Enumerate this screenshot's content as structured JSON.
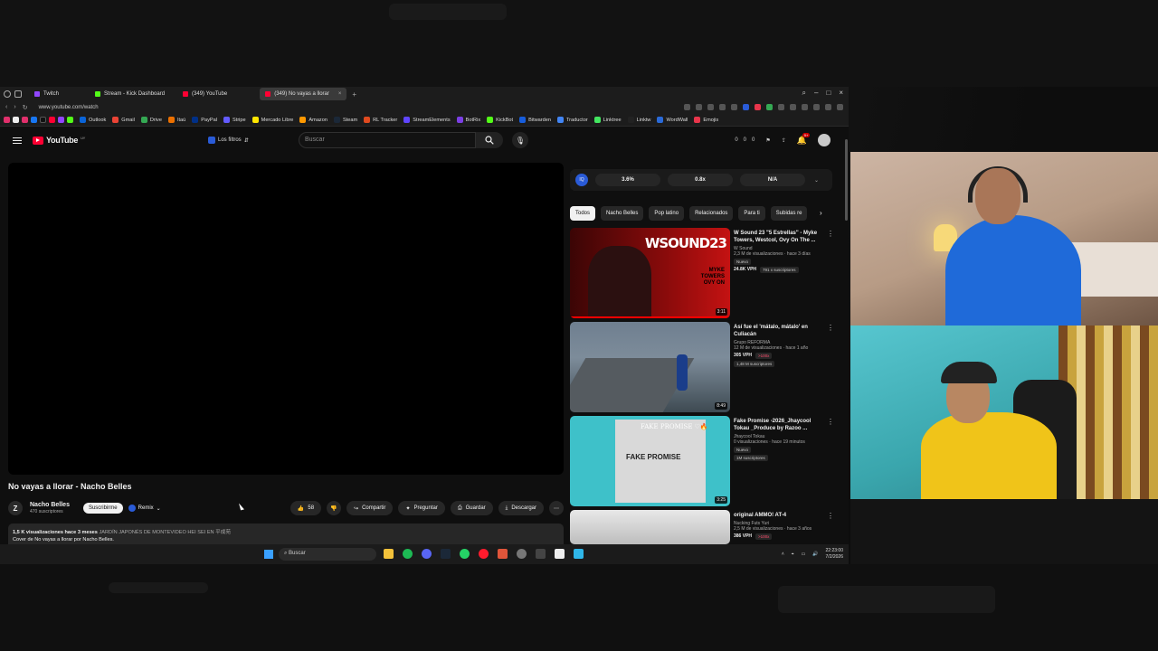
{
  "browser": {
    "tabs": [
      {
        "label": "Twitch",
        "color": "#9146ff",
        "active": false
      },
      {
        "label": "Stream - Kick Dashboard",
        "color": "#53fc18",
        "active": false
      },
      {
        "label": "(349) YouTube",
        "color": "#ff0033",
        "active": false
      },
      {
        "label": "(349) No vayas a llorar",
        "color": "#ff0033",
        "active": true
      }
    ],
    "url": "www.youtube.com/watch",
    "bookmarks": [
      {
        "label": "Outlook",
        "color": "#0a64d8"
      },
      {
        "label": "Gmail",
        "color": "#ea4335"
      },
      {
        "label": "Drive",
        "color": "#34a853"
      },
      {
        "label": "Itaú",
        "color": "#ec7000"
      },
      {
        "label": "PayPal",
        "color": "#003087"
      },
      {
        "label": "Stripe",
        "color": "#635bff"
      },
      {
        "label": "Mercado Libre",
        "color": "#ffe600"
      },
      {
        "label": "Amazon",
        "color": "#ff9900"
      },
      {
        "label": "Steam",
        "color": "#1b2838"
      },
      {
        "label": "RL Tracker",
        "color": "#e04a1f"
      },
      {
        "label": "StreamElements",
        "color": "#5f45ff"
      },
      {
        "label": "BotRix",
        "color": "#7b3fe4"
      },
      {
        "label": "KickBot",
        "color": "#53fc18"
      },
      {
        "label": "Bitwarden",
        "color": "#175ddc"
      },
      {
        "label": "Traductor",
        "color": "#4285f4"
      },
      {
        "label": "Linktree",
        "color": "#43e660"
      },
      {
        "label": "Linktw",
        "color": "#222222"
      },
      {
        "label": "WordWall",
        "color": "#2a6ad8"
      },
      {
        "label": "Emojis",
        "color": "#e8354b"
      }
    ]
  },
  "youtube": {
    "logo_text": "YouTube",
    "logo_region": "UY",
    "filters_label": "Los filtros",
    "search_placeholder": "Buscar",
    "header_counters": [
      "0",
      "0",
      "0"
    ],
    "notifications": "9+"
  },
  "video": {
    "title": "No vayas a llorar - Nacho Belles",
    "channel": "Nacho Belles",
    "channel_initial": "Z",
    "subscribers": "470 suscriptores",
    "subscribe_label": "Suscribirme",
    "remix_label": "Remix",
    "likes": "58",
    "share_label": "Compartir",
    "ask_label": "Preguntar",
    "save_label": "Guardar",
    "download_label": "Descargar",
    "views_line": "1,5 K visualizaciones  hace 3 meses",
    "tags_line": "JARDÍN JAPONÉS DE MONTEVIDEO HEI SEI EN 平成苑",
    "description": "Cover de No vayas a llorar por Nacho Belles."
  },
  "extension": {
    "badge": "IQ",
    "stats": [
      "3.6%",
      "0.8x",
      "N/A"
    ]
  },
  "chips": [
    "Todos",
    "Nacho Belles",
    "Pop latino",
    "Relacionados",
    "Para ti",
    "Subidas re"
  ],
  "recommendations": [
    {
      "title": "W Sound 23 \"5 Estrellas\" - Myke Towers, Westcol, Ovy On The ...",
      "channel": "W Sound",
      "meta": "2,3 M de visualizaciones · hace 3 días",
      "badge": "Nuevo",
      "vph": "24.8K VPH",
      "extra": "791 x suscriptores",
      "duration": "3:11",
      "thumb_word": "WSOUND23",
      "thumb_sub": "MYKE\nTOWERS\nOVY ON"
    },
    {
      "title": "Así fue el 'mátalo, mátalo' en Culiacán",
      "channel": "Grupo REFORMA",
      "meta": "12 M de visualizaciones · hace 1 año",
      "badge": "",
      "vph": "305 VPH",
      "extra": ">100x",
      "extra2": "1,48 M suscriptores",
      "duration": "8:49"
    },
    {
      "title": "Fake Promise -2026_Jhaycool Tokau _Produce by Razoo ...",
      "channel": "Jhaycool Tokau",
      "meta": "0 visualizaciones · hace 19 minutos",
      "badge": "Nuevo",
      "vph": "",
      "extra": "1M suscriptores",
      "duration": "3:25",
      "thumb_word": "FAKE PROMISE",
      "thumb_label": "FAKE PROMISE ♡🔥"
    },
    {
      "title": "original AMMO! AT-4",
      "channel": "Nucking Futs Yuri",
      "meta": "2,5 M de visualizaciones · hace 3 años",
      "badge": "",
      "vph": "386 VPH",
      "extra": ">100x",
      "duration": ""
    }
  ],
  "taskbar": {
    "search_placeholder": "Buscar",
    "time": "22:23:00",
    "date": "7/2/2026"
  }
}
